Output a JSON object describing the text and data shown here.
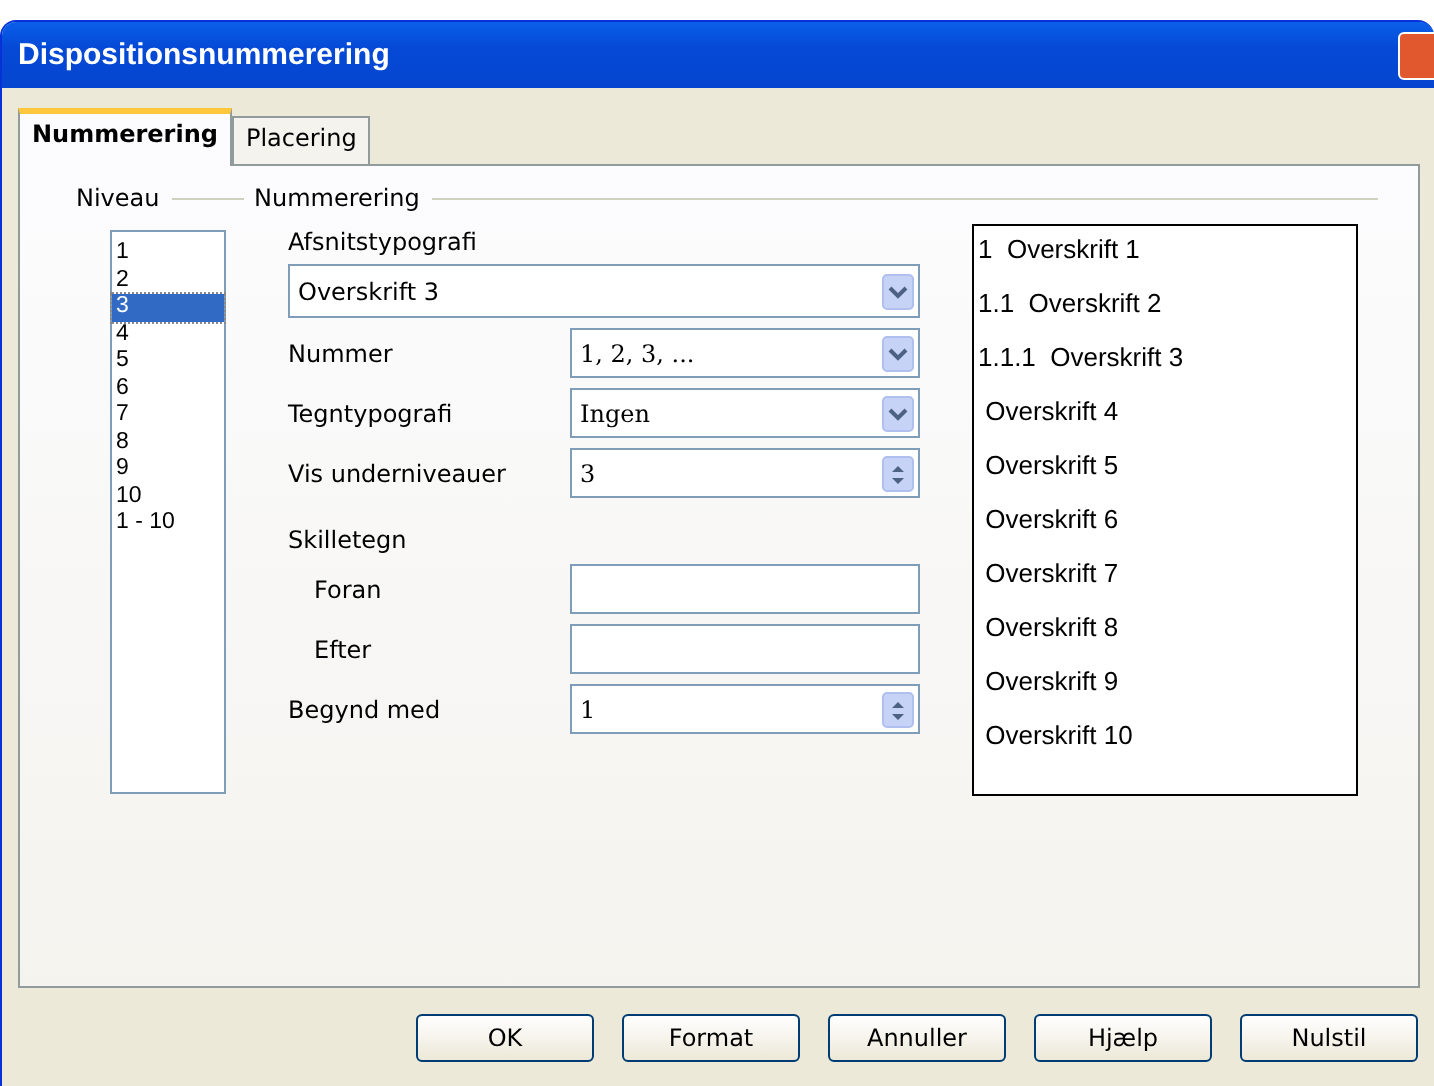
{
  "window": {
    "title": "Dispositionsnummerering"
  },
  "tabs": [
    {
      "label": "Nummerering",
      "selected": true
    },
    {
      "label": "Placering",
      "selected": false
    }
  ],
  "levels": {
    "label": "Niveau",
    "items": [
      {
        "label": "1",
        "selected": false
      },
      {
        "label": "2",
        "selected": false
      },
      {
        "label": "3",
        "selected": true
      },
      {
        "label": "4",
        "selected": false
      },
      {
        "label": "5",
        "selected": false
      },
      {
        "label": "6",
        "selected": false
      },
      {
        "label": "7",
        "selected": false
      },
      {
        "label": "8",
        "selected": false
      },
      {
        "label": "9",
        "selected": false
      },
      {
        "label": "10",
        "selected": false
      },
      {
        "label": "1 - 10",
        "selected": false
      }
    ]
  },
  "numbering": {
    "label": "Nummerering",
    "paragraph_style": {
      "label": "Afsnitstypografi",
      "value": "Overskrift 3"
    },
    "rows": [
      {
        "kind": "dropdown",
        "label": "Nummer",
        "value": "1, 2, 3, ..."
      },
      {
        "kind": "dropdown",
        "label": "Tegntypografi",
        "value": "Ingen"
      },
      {
        "kind": "spin",
        "label": "Vis underniveauer",
        "value": "3"
      },
      {
        "kind": "heading",
        "label": "Skilletegn"
      },
      {
        "kind": "text",
        "label": "Foran"
      },
      {
        "kind": "text",
        "label": "Efter"
      },
      {
        "kind": "spin",
        "label": "Begynd med",
        "value": "1"
      }
    ]
  },
  "preview": [
    "1  Overskrift 1",
    "1.1  Overskrift 2",
    "1.1.1  Overskrift 3",
    " Overskrift 4",
    " Overskrift 5",
    " Overskrift 6",
    " Overskrift 7",
    " Overskrift 8",
    " Overskrift 9",
    " Overskrift 10"
  ],
  "buttons": [
    "OK",
    "Format",
    "Annuller",
    "Hjælp",
    "Nulstil"
  ]
}
